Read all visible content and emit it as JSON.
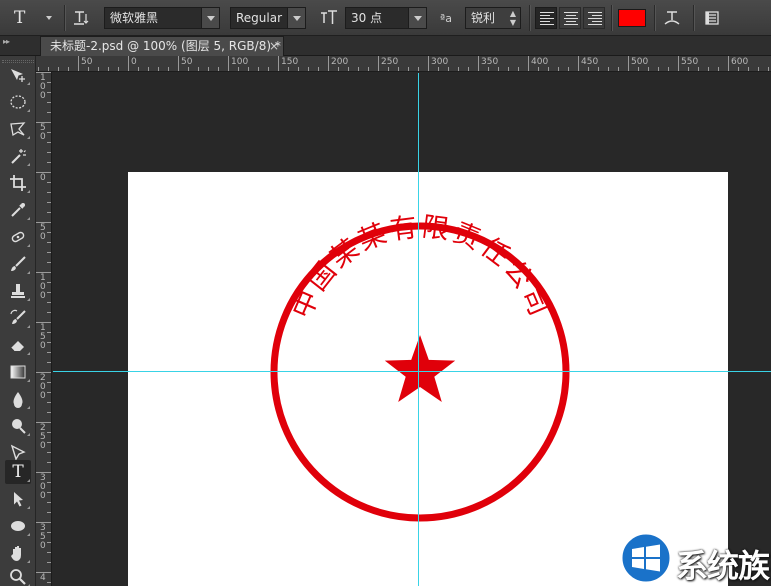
{
  "options_bar": {
    "tool_glyph": "T",
    "font_family": "微软雅黑",
    "font_style": "Regular",
    "font_size": "30 点",
    "aa_icon_glyph": "ªa",
    "antialias": "锐利",
    "text_color": "#ff0000",
    "icons": [
      "type-tool-icon",
      "text-orientation-icon",
      "font-size-icon",
      "anti-alias-icon",
      "align-left-icon",
      "align-center-icon",
      "align-right-icon",
      "warp-text-icon",
      "character-panel-icon"
    ]
  },
  "document_tab": {
    "title": "未标题-2.psd @ 100% (图层 5, RGB/8) *",
    "close_glyph": "×",
    "collapse_glyph": "▸▸"
  },
  "rulers": {
    "top_labels": [
      "50",
      "0",
      "50",
      "100",
      "150",
      "200",
      "250",
      "300",
      "350",
      "400",
      "450",
      "500",
      "550",
      "600"
    ],
    "left_labels": [
      "100",
      "50",
      "0",
      "50",
      "100",
      "150",
      "200",
      "250",
      "300",
      "350",
      "4"
    ]
  },
  "toolbox": {
    "tools": [
      "move-tool-icon",
      "ellipse-marquee-tool-icon",
      "polygonal-lasso-tool-icon",
      "magic-wand-tool-icon",
      "crop-tool-icon",
      "eyedropper-tool-icon",
      "spot-healing-tool-icon",
      "brush-tool-icon",
      "clone-stamp-tool-icon",
      "history-brush-tool-icon",
      "eraser-tool-icon",
      "gradient-tool-icon",
      "blur-tool-icon",
      "dodge-tool-icon",
      "pen-tool-icon",
      "type-tool-icon",
      "path-selection-tool-icon",
      "ellipse-tool-icon",
      "hand-tool-icon",
      "zoom-tool-icon"
    ],
    "active_tool": "type-tool-icon"
  },
  "canvas": {
    "background": "#ffffff",
    "stamp_color": "#e0000a",
    "stamp_text": "中国某某有限责任公司",
    "guide_color": "#39d3e6"
  },
  "watermark": {
    "text": "系统族",
    "logo": "windows-logo-icon"
  }
}
